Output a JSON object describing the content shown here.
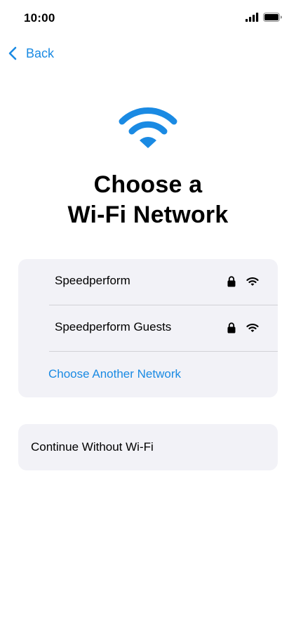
{
  "status_bar": {
    "time": "10:00",
    "icons": [
      "cellular-signal-icon",
      "battery-icon"
    ]
  },
  "nav": {
    "back_label": "Back",
    "back_icon": "chevron-left-icon"
  },
  "hero": {
    "icon": "wifi-icon",
    "title": "Choose a\nWi-Fi Network"
  },
  "networks": [
    {
      "name": "Speedperform",
      "secured": true,
      "icons": [
        "lock-icon",
        "wifi-signal-icon"
      ]
    },
    {
      "name": "Speedperform Guests",
      "secured": true,
      "icons": [
        "lock-icon",
        "wifi-signal-icon"
      ]
    }
  ],
  "other_network_label": "Choose Another Network",
  "continue_label": "Continue Without Wi-Fi",
  "colors": {
    "accent": "#1a8ae3",
    "card_background": "#f2f2f7",
    "divider": "#d1d1d6",
    "text": "#000000",
    "background": "#ffffff"
  }
}
